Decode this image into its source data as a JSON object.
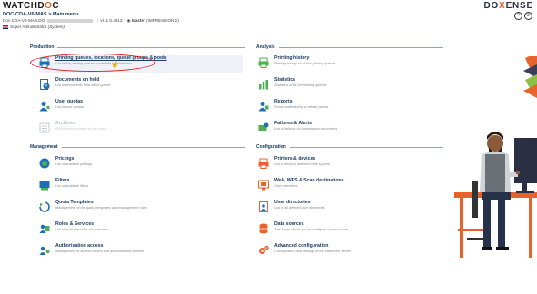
{
  "header": {
    "logo_left_a": "WATCHD",
    "logo_left_b": "O",
    "logo_left_c": "C",
    "logo_right_a": "DO",
    "logo_right_b": "X",
    "logo_right_c": "ENSE",
    "breadcrumb": "DOC-CDA-V6-MAS > Main menu",
    "server_name": "Doc-CDA-V6-MAS.DO",
    "version": "v6.1.0.4913",
    "master_label": "Master",
    "master_edition": "(IMPRESSION 1)",
    "user": "Super Administrator",
    "user_role": "(System)"
  },
  "sections": {
    "production": "Production",
    "analysis": "Analysis",
    "management": "Management",
    "configuration": "Configuration"
  },
  "production": [
    {
      "title": "Printing queues, locations, queue groups & pools",
      "subtitle": "List of the printing queues controlled by Watchdoc"
    },
    {
      "title": "Documents on hold",
      "subtitle": "List of documents held in the queue"
    },
    {
      "title": "User quotas",
      "subtitle": "List of user quotas"
    },
    {
      "title": "Archives",
      "subtitle": "Documents archived by the users"
    }
  ],
  "analysis": [
    {
      "title": "Printing history",
      "subtitle": "Printing history of all the printing queues"
    },
    {
      "title": "Statistics",
      "subtitle": "Statistics of all the printing queues"
    },
    {
      "title": "Reports",
      "subtitle": "Prints made during a certain period"
    },
    {
      "title": "Failures & Alerts",
      "subtitle": "List of failures on queues and documents"
    }
  ],
  "management": [
    {
      "title": "Pricings",
      "subtitle": "List of available pricings"
    },
    {
      "title": "Filters",
      "subtitle": "List of available filters"
    },
    {
      "title": "Quota Templates",
      "subtitle": "Management of the quota templates and management rules"
    },
    {
      "title": "Roles & Services",
      "subtitle": "List of available roles and services"
    },
    {
      "title": "Authorisation access",
      "subtitle": "Management of access control and administration profiles"
    }
  ],
  "configuration": [
    {
      "title": "Printers & devices",
      "subtitle": "List of devices defined in the system"
    },
    {
      "title": "Web, WES & Scan destinations",
      "subtitle": "User interfaces"
    },
    {
      "title": "User directories",
      "subtitle": "List of all defined user directories"
    },
    {
      "title": "Data sources",
      "subtitle": "The forms allows you to configure a data source"
    },
    {
      "title": "Advanced configuration",
      "subtitle": "Configuration and settings of the Watchdoc server"
    }
  ],
  "colors": {
    "title_blue": "#1c3b66",
    "accent_orange": "#e8622c",
    "icon_green": "#4caf50",
    "icon_blue": "#1e6fb8",
    "highlight_red": "#d81b1b"
  }
}
